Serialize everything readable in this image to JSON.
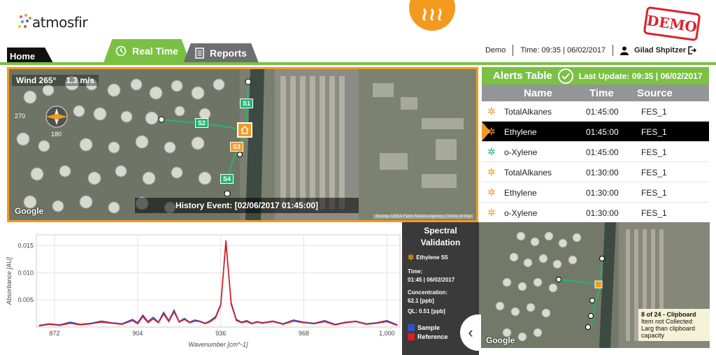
{
  "app": {
    "logo_text": "atmosfir",
    "demo_stamp": "DEMO"
  },
  "tabs": {
    "home": "Home",
    "real_time": "Real Time",
    "reports": "Reports"
  },
  "topbar": {
    "mode": "Demo",
    "time_label": "Time: 09:35 | 06/02/2017",
    "user": "Gilad Shpitzer"
  },
  "map": {
    "wind_dir": "Wind 265°",
    "wind_speed": "1.3 m/s",
    "compass_270": "270",
    "compass_180": "180",
    "sensors": [
      "S1",
      "S2",
      "S3",
      "S4"
    ],
    "history_event": "History Event: [02/06/2017 01:45:00]",
    "google": "Google",
    "attribution": "Survey, USDA Farm Service Agency | Terms of Use"
  },
  "alerts": {
    "title": "Alerts Table",
    "last_update": "Last Update: 09:35 | 06/02/2017",
    "columns": [
      "Name",
      "Time",
      "Source"
    ],
    "rows": [
      {
        "name": "TotalAlkanes",
        "time": "01:45:00",
        "source": "FES_1",
        "marker_color": "#f39a1e"
      },
      {
        "name": "Ethylene",
        "time": "01:45:00",
        "source": "FES_1",
        "marker_color": "#f39a1e"
      },
      {
        "name": "o-Xylene",
        "time": "01:45:00",
        "source": "FES_1",
        "marker_color": "#22b573"
      },
      {
        "name": "TotalAlkanes",
        "time": "01:30:00",
        "source": "FES_1",
        "marker_color": "#f39a1e"
      },
      {
        "name": "Ethylene",
        "time": "01:30:00",
        "source": "FES_1",
        "marker_color": "#f39a1e"
      },
      {
        "name": "o-Xylene",
        "time": "01:30:00",
        "source": "FES_1",
        "marker_color": "#f39a1e"
      }
    ],
    "selected_row": 1
  },
  "spectral": {
    "title_line1": "Spectral",
    "title_line2": "Validation",
    "gas": "Ethylene S5",
    "time_label": "Time:",
    "time_value": "01:45 | 06/02/2017",
    "conc_label": "Concentration:",
    "conc_value": "62.1 [ppb]",
    "ql": "QL: 0.51 [ppb]",
    "legend_sample": "Sample",
    "legend_reference": "Reference",
    "sample_color": "#3050c8",
    "reference_color": "#e41a1c"
  },
  "minimap": {
    "google": "Google",
    "clipboard_title": "8 of 24 - Clipboard",
    "clipboard_text": "Item not Collected: Larg than clipboard capacity"
  },
  "chart_data": {
    "type": "line",
    "xlabel": "Wavenumber [cm^-1]",
    "ylabel": "Absorbance [AU]",
    "xlim": [
      865,
      1005
    ],
    "ylim": [
      0,
      0.017
    ],
    "xticks": [
      "872",
      "904",
      "936",
      "968",
      "1,000"
    ],
    "xtick_values": [
      872,
      904,
      936,
      968,
      1000
    ],
    "yticks": [
      "0.005",
      "0.010",
      "0.015"
    ],
    "ytick_values": [
      0.005,
      0.01,
      0.015
    ],
    "grid": true,
    "series": [
      {
        "name": "Sample",
        "x": [
          866,
          870,
          874,
          878,
          882,
          886,
          890,
          894,
          898,
          902,
          904,
          906,
          908,
          910,
          912,
          914,
          916,
          918,
          920,
          922,
          924,
          926,
          928,
          930,
          932,
          934,
          936,
          938,
          940,
          942,
          944,
          946,
          948,
          950,
          952,
          956,
          960,
          964,
          968,
          972,
          976,
          980,
          984,
          988,
          992,
          996,
          1000,
          1004
        ],
        "y": [
          0.0003,
          0.0006,
          0.0004,
          0.0009,
          0.0005,
          0.0007,
          0.0011,
          0.0008,
          0.0006,
          0.0014,
          0.0008,
          0.0022,
          0.001,
          0.0018,
          0.0009,
          0.0027,
          0.0012,
          0.0031,
          0.001,
          0.0016,
          0.0009,
          0.0013,
          0.0011,
          0.0007,
          0.0012,
          0.0019,
          0.0042,
          0.0155,
          0.0045,
          0.0014,
          0.0009,
          0.0012,
          0.0007,
          0.001,
          0.0008,
          0.0011,
          0.0006,
          0.0013,
          0.0009,
          0.0007,
          0.0012,
          0.0005,
          0.0009,
          0.0011,
          0.0006,
          0.0008,
          0.0012,
          0.0004
        ]
      },
      {
        "name": "Reference",
        "x": [
          866,
          870,
          874,
          878,
          882,
          886,
          890,
          894,
          898,
          902,
          904,
          906,
          908,
          910,
          912,
          914,
          916,
          918,
          920,
          922,
          924,
          926,
          928,
          930,
          932,
          934,
          936,
          938,
          940,
          942,
          944,
          946,
          948,
          950,
          952,
          956,
          960,
          964,
          968,
          972,
          976,
          980,
          984,
          988,
          992,
          996,
          1000,
          1004
        ],
        "y": [
          0.0002,
          0.0005,
          0.0003,
          0.0007,
          0.0004,
          0.0006,
          0.0009,
          0.0007,
          0.0005,
          0.0012,
          0.0006,
          0.0019,
          0.0008,
          0.0015,
          0.0008,
          0.0024,
          0.001,
          0.0028,
          0.0009,
          0.0014,
          0.0008,
          0.0011,
          0.001,
          0.0006,
          0.001,
          0.0017,
          0.004,
          0.016,
          0.0042,
          0.0012,
          0.0008,
          0.001,
          0.0006,
          0.0009,
          0.0007,
          0.001,
          0.0005,
          0.0011,
          0.0008,
          0.0006,
          0.001,
          0.0004,
          0.0008,
          0.001,
          0.0005,
          0.0007,
          0.001,
          0.0003
        ]
      }
    ]
  }
}
